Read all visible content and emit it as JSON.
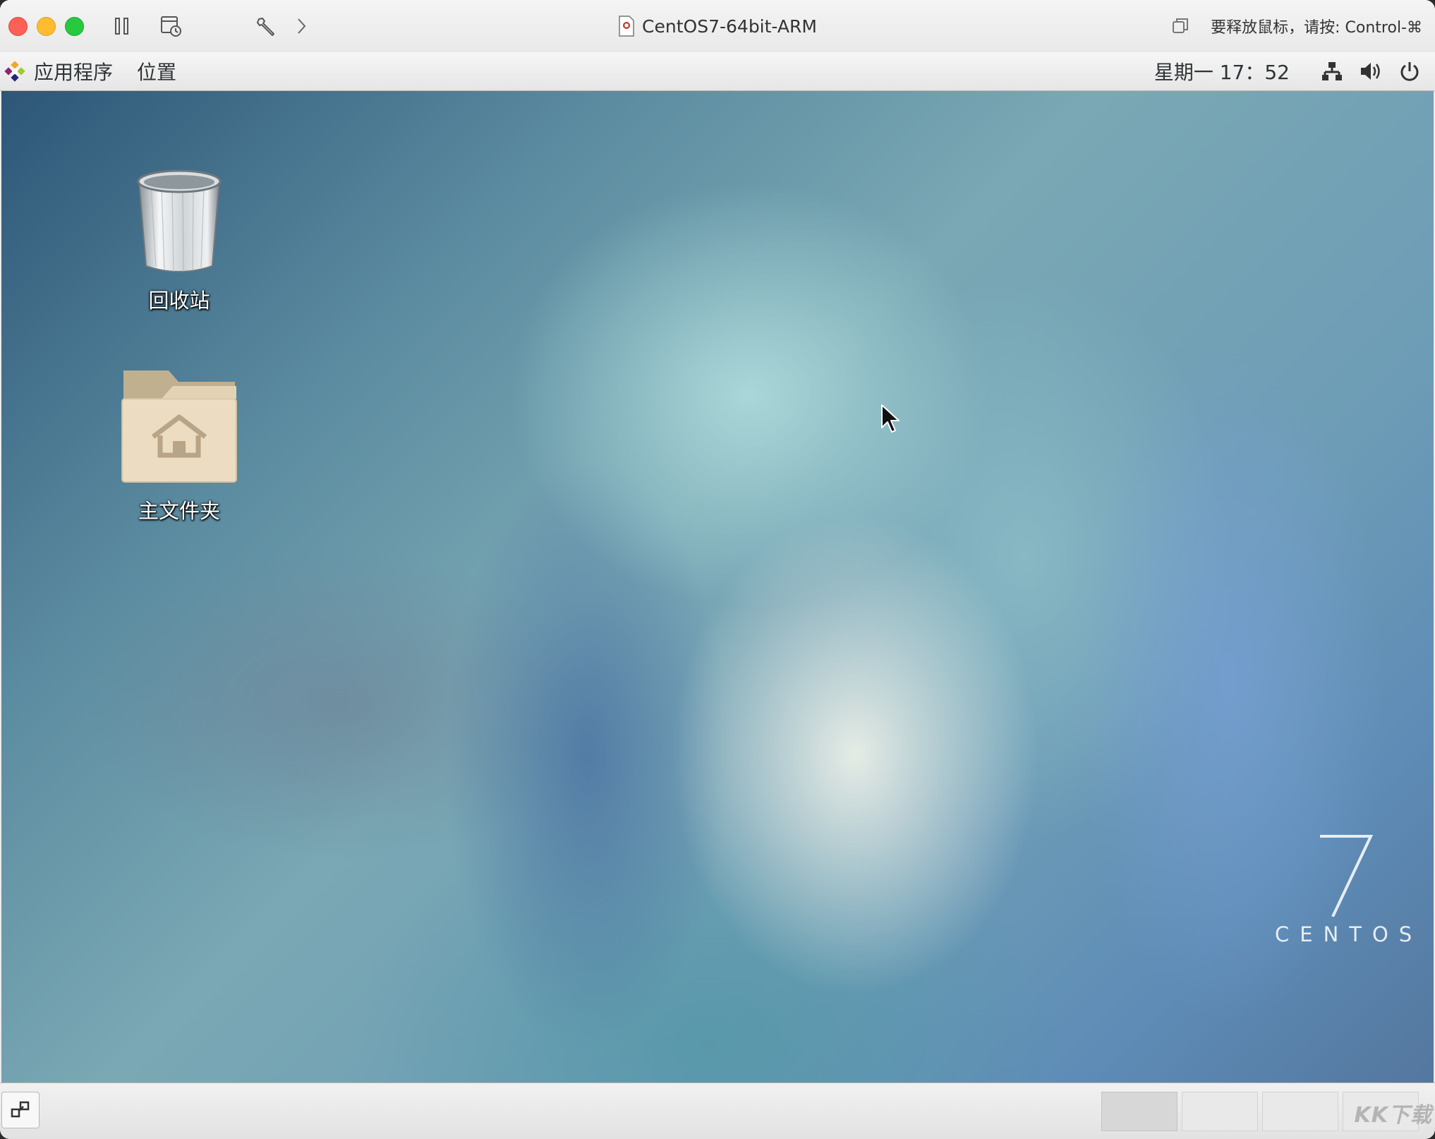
{
  "window": {
    "title": "CentOS7-64bit-ARM",
    "release_hint": "要释放鼠标，请按: Control-⌘"
  },
  "panel": {
    "applications_menu": "应用程序",
    "places_menu": "位置",
    "clock": "星期一 17：52"
  },
  "desktop": {
    "icons": [
      {
        "label": "回收站",
        "icon": "trash-icon"
      },
      {
        "label": "主文件夹",
        "icon": "home-folder-icon"
      }
    ],
    "logo": {
      "number": "7",
      "text": "CENTOS"
    }
  },
  "bottom_panel": {
    "workspaces": 4,
    "active_workspace": 1,
    "watermark": "KK下载"
  },
  "colors": {
    "close": "#fe5f57",
    "minimize": "#febc2e",
    "maximize": "#28c840",
    "panel": "#ececec"
  }
}
